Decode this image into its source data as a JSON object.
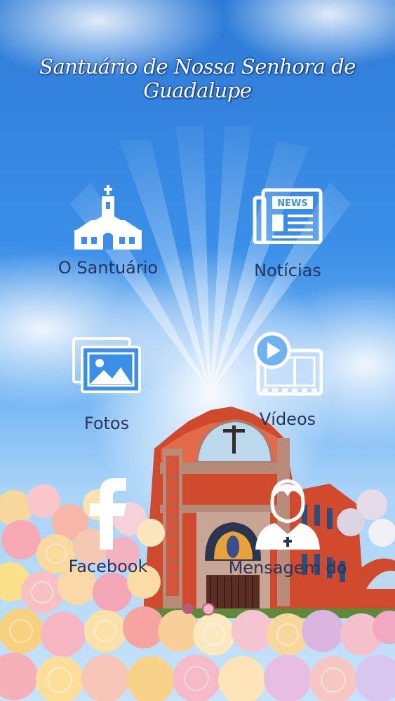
{
  "app": {
    "title": "Santuário de Nossa Senhora de Guadalupe"
  },
  "menu": [
    {
      "id": "santuario",
      "label": "O Santuário",
      "icon": "church-icon"
    },
    {
      "id": "noticias",
      "label": "Notícias",
      "icon": "newspaper-icon"
    },
    {
      "id": "fotos",
      "label": "Fotos",
      "icon": "photos-icon"
    },
    {
      "id": "videos",
      "label": "Vídeos",
      "icon": "video-film-icon"
    },
    {
      "id": "facebook",
      "label": "Facebook",
      "icon": "facebook-icon"
    },
    {
      "id": "mensagem",
      "label": "Mensagem do",
      "icon": "priest-icon"
    }
  ],
  "newspaper_badge": "NEWS",
  "pager": {
    "pages": 2,
    "current": 2
  },
  "colors": {
    "label_text": "#27345e",
    "church_brick": "#d9472a",
    "sky_top": "#2d7ad6"
  }
}
